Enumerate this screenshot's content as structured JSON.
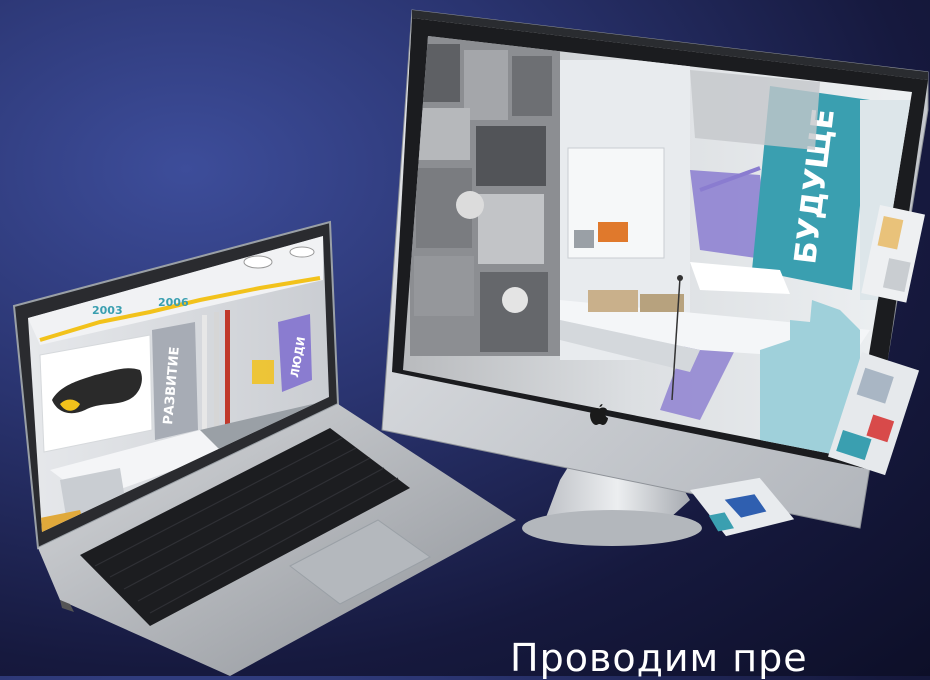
{
  "headline": "Проводим пре",
  "laptop_screen": {
    "years": [
      "2003",
      "2006"
    ],
    "wall_labels": [
      "ЛЮДИ",
      "РАЗВИТИЕ"
    ]
  },
  "monitor_screen": {
    "wall_label": "БУДУЩЕ"
  },
  "devices": {
    "laptop_color": "#c8cbd0",
    "monitor_color": "#d8dadd",
    "accent_teal": "#3a9fb0",
    "accent_purple": "#8a7cd0",
    "accent_yellow": "#f2c21b"
  },
  "icons": [
    "apple-logo-icon"
  ]
}
